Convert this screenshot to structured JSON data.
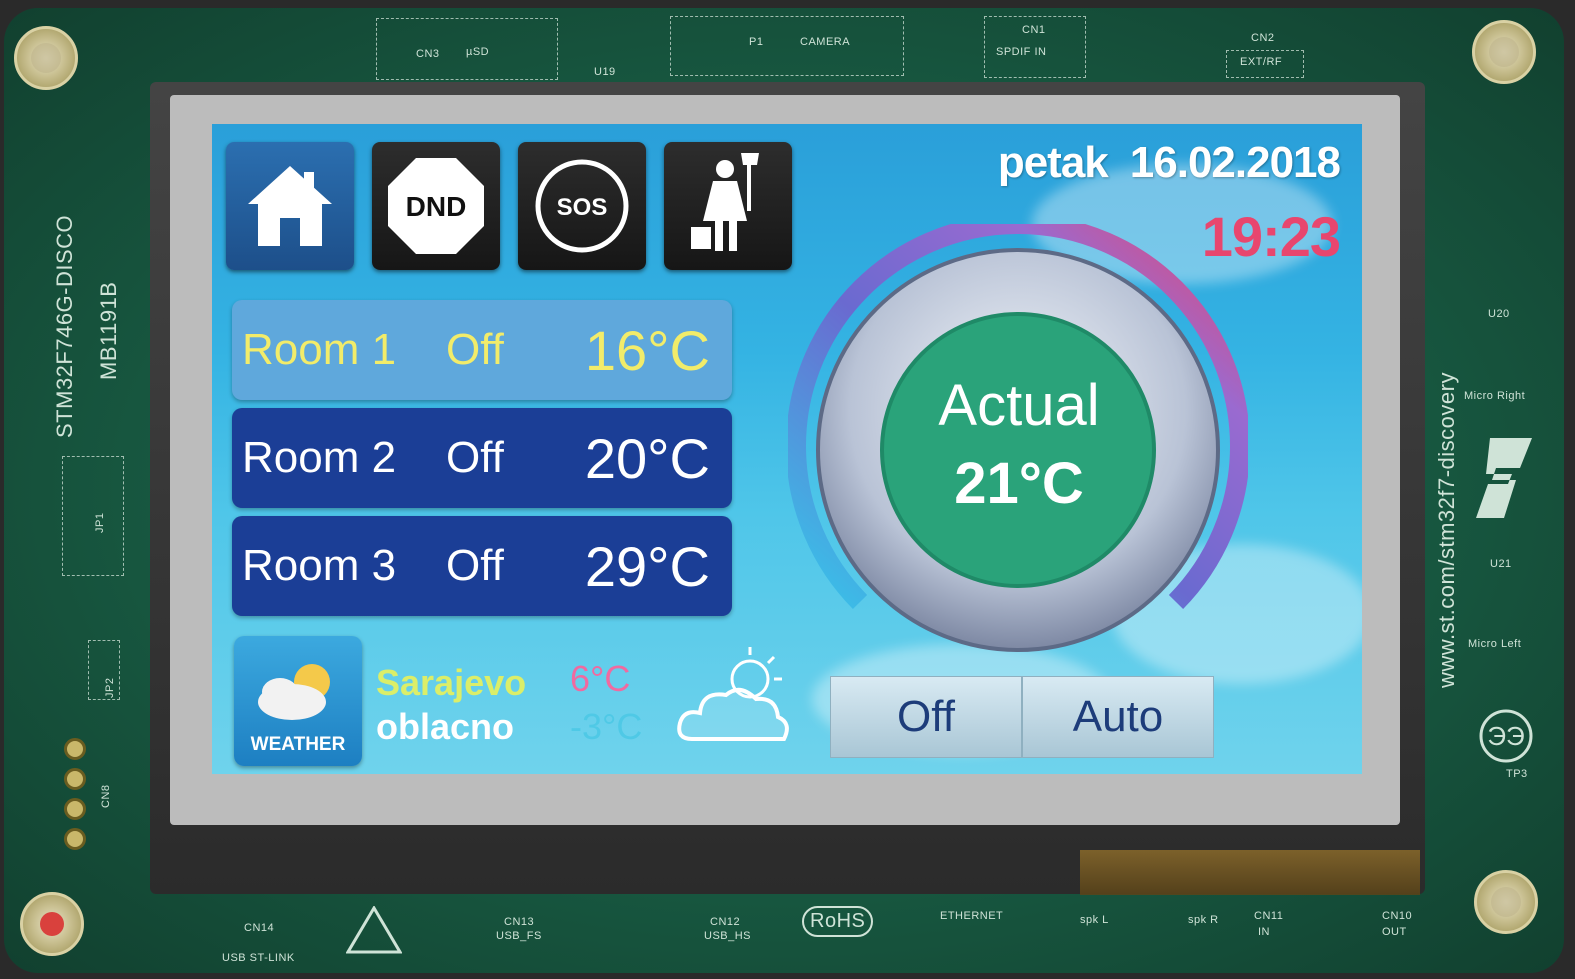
{
  "board": {
    "model": "STM32F746G-DISCO",
    "part": "MB1191B",
    "url": "www.st.com/stm32f7-discovery",
    "jp1": "JP1",
    "jp2": "JP2",
    "cn8": "CN8",
    "silkscreen": {
      "cn3": "CN3",
      "usd": "µSD",
      "u19": "U19",
      "p1": "P1",
      "camera": "CAMERA",
      "cn1": "CN1",
      "spdif": "SPDIF IN",
      "cn2": "CN2",
      "extrf": "EXT/RF",
      "u20": "U20",
      "micro_right": "Micro Right",
      "u21": "U21",
      "micro_left": "Micro Left",
      "tp3": "TP3",
      "cn14": "CN14",
      "usb_stlink": "USB ST-LINK",
      "cn13": "CN13",
      "usb_fs": "USB_FS",
      "cn12": "CN12",
      "usb_hs": "USB_HS",
      "rohs": "RoHS",
      "ethernet": "ETHERNET",
      "spkl": "spk L",
      "spkr": "spk R",
      "cn11": "CN11",
      "in": "IN",
      "cn10": "CN10",
      "out": "OUT"
    }
  },
  "toolbar": {
    "home_icon": "home-icon",
    "dnd_label": "DND",
    "sos_label": "SOS",
    "housekeeping_icon": "housekeeping-icon"
  },
  "header": {
    "day": "petak",
    "date": "16.02.2018",
    "time": "19:23"
  },
  "rooms": [
    {
      "name": "Room 1",
      "state": "Off",
      "temp": "16°C",
      "selected": true
    },
    {
      "name": "Room 2",
      "state": "Off",
      "temp": "20°C",
      "selected": false
    },
    {
      "name": "Room 3",
      "state": "Off",
      "temp": "29°C",
      "selected": false
    }
  ],
  "thermostat": {
    "label": "Actual",
    "value": "21°C"
  },
  "weather": {
    "button_label": "WEATHER",
    "city": "Sarajevo",
    "condition": "oblacno",
    "temp_max": "6°C",
    "temp_min": "-3°C"
  },
  "modes": {
    "off_label": "Off",
    "auto_label": "Auto"
  },
  "colors": {
    "room_selected_bg": "#5fa8dc",
    "room_bg": "#1b3e96",
    "time": "#e8466e",
    "thermostat_center": "#2aa37a"
  }
}
